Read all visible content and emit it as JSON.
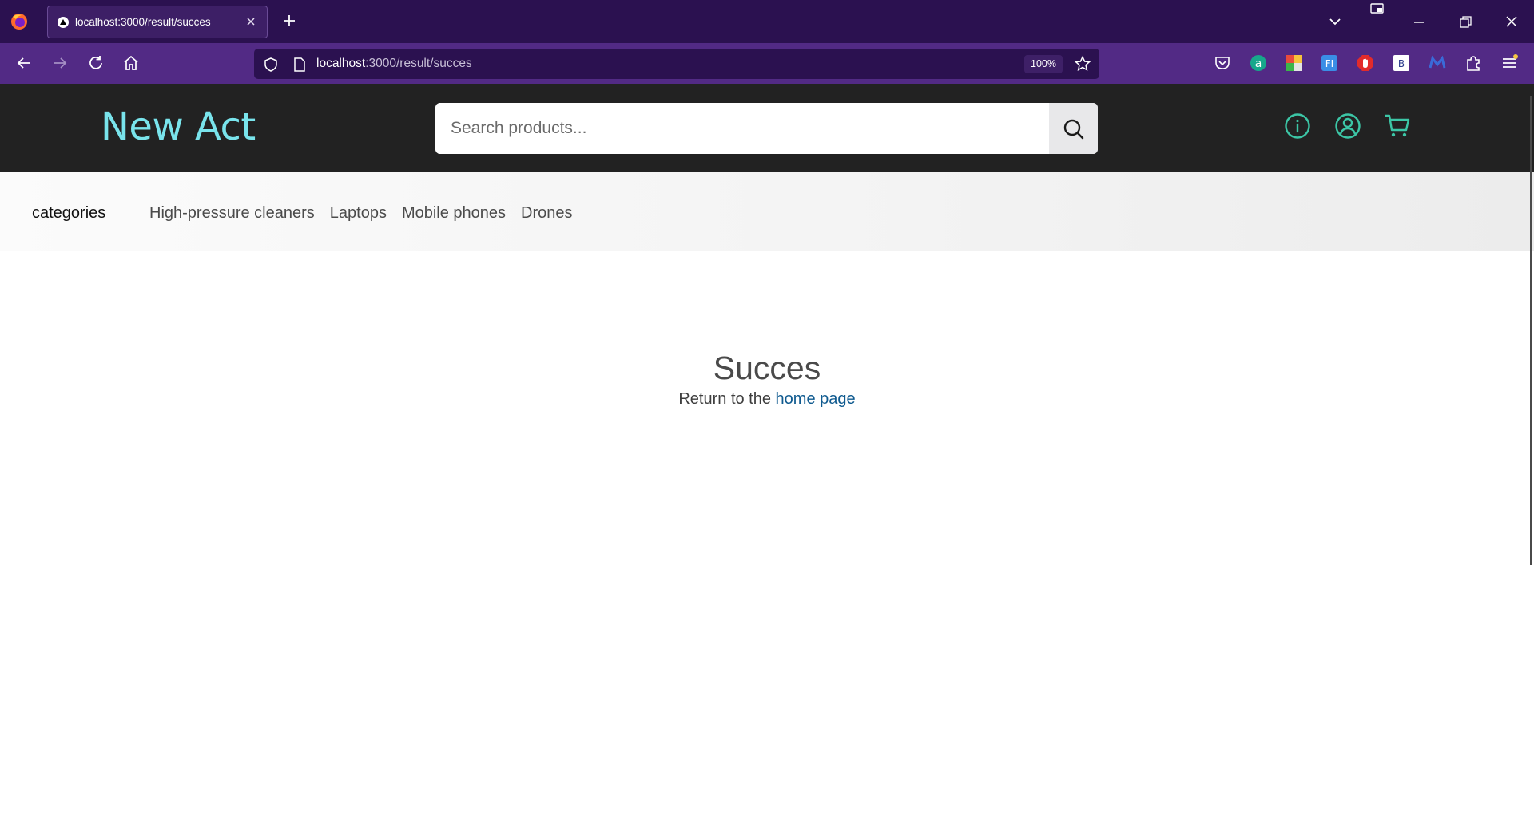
{
  "browser": {
    "tab_title": "localhost:3000/result/succes",
    "url_host": "localhost",
    "url_path": ":3000/result/succes",
    "zoom": "100%"
  },
  "site": {
    "brand": "New Act",
    "search_placeholder": "Search products...",
    "header_icons": [
      "info-icon",
      "user-account-icon",
      "cart-icon"
    ],
    "accent_color": "#79e4ec",
    "icon_color": "#3cc6a6"
  },
  "categories": {
    "heading": "categories",
    "items": [
      {
        "label": "High-pressure cleaners"
      },
      {
        "label": "Laptops"
      },
      {
        "label": "Mobile phones"
      },
      {
        "label": "Drones"
      }
    ]
  },
  "result": {
    "title": "Succes",
    "message_prefix": "Return to the ",
    "link_text": "home page"
  }
}
